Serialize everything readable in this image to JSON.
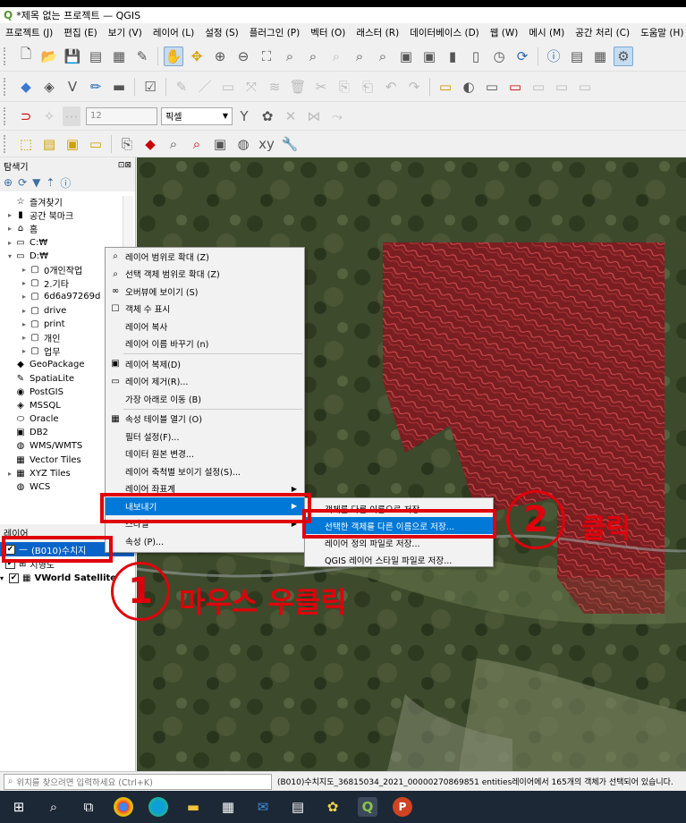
{
  "window": {
    "title": "*제목 없는 프로젝트 — QGIS",
    "logo": "qgis-logo"
  },
  "menubar": [
    "프로젝트 (J)",
    "편집 (E)",
    "보기 (V)",
    "레이어 (L)",
    "설정 (S)",
    "플러그인 (P)",
    "벡터 (O)",
    "래스터 (R)",
    "데이터베이스 (D)",
    "웹 (W)",
    "메시 (M)",
    "공간 처리 (C)",
    "도움말 (H)"
  ],
  "digitize_toolbar": {
    "font_size_value": "12",
    "unit_value": "픽셀"
  },
  "browser_panel": {
    "title": "탐색기",
    "items": [
      {
        "label": "즐겨찾기",
        "icon": "star-icon",
        "expand": ""
      },
      {
        "label": "공간 북마크",
        "icon": "bookmark-icon",
        "expand": "▸"
      },
      {
        "label": "홈",
        "icon": "home-icon",
        "expand": "▸"
      },
      {
        "label": "C:₩",
        "icon": "drive-icon",
        "expand": "▸"
      },
      {
        "label": "D:₩",
        "icon": "drive-icon",
        "expand": "▾"
      },
      {
        "label": "0개인작업",
        "icon": "folder-icon",
        "expand": "▸",
        "indent": 1
      },
      {
        "label": "2.기타",
        "icon": "folder-icon",
        "expand": "▸",
        "indent": 1
      },
      {
        "label": "6d6a97269d",
        "icon": "folder-icon",
        "expand": "▸",
        "indent": 1
      },
      {
        "label": "drive",
        "icon": "folder-icon",
        "expand": "▸",
        "indent": 1
      },
      {
        "label": "print",
        "icon": "folder-icon",
        "expand": "▸",
        "indent": 1
      },
      {
        "label": "개인",
        "icon": "folder-icon",
        "expand": "▸",
        "indent": 1
      },
      {
        "label": "업무",
        "icon": "folder-icon",
        "expand": "▸",
        "indent": 1
      },
      {
        "label": "GeoPackage",
        "icon": "geopackage-icon",
        "expand": ""
      },
      {
        "label": "SpatiaLite",
        "icon": "spatialite-icon",
        "expand": ""
      },
      {
        "label": "PostGIS",
        "icon": "postgis-icon",
        "expand": ""
      },
      {
        "label": "MSSQL",
        "icon": "mssql-icon",
        "expand": ""
      },
      {
        "label": "Oracle",
        "icon": "oracle-icon",
        "expand": ""
      },
      {
        "label": "DB2",
        "icon": "db2-icon",
        "expand": ""
      },
      {
        "label": "WMS/WMTS",
        "icon": "wms-icon",
        "expand": ""
      },
      {
        "label": "Vector Tiles",
        "icon": "vector-tiles-icon",
        "expand": ""
      },
      {
        "label": "XYZ Tiles",
        "icon": "xyz-tiles-icon",
        "expand": "▸"
      },
      {
        "label": "WCS",
        "icon": "wcs-icon",
        "expand": ""
      }
    ]
  },
  "layers_panel": {
    "title": "레이어",
    "layers": [
      {
        "label": "(B010)수치지",
        "checked": true,
        "selected": true
      },
      {
        "label": "지형도",
        "checked": true,
        "selected": false
      },
      {
        "label": "VWorld Satellite",
        "checked": true,
        "selected": false
      }
    ]
  },
  "context_menu": {
    "items": [
      {
        "label": "레이어 범위로 확대 (Z)",
        "icon": "zoom-layer-icon"
      },
      {
        "label": "선택 객체 범위로 확대 (Z)",
        "icon": "zoom-selected-icon"
      },
      {
        "label": "오버뷰에 보이기 (S)",
        "icon": "overview-icon"
      },
      {
        "label": "객체 수 표시",
        "icon": "checkbox-icon"
      },
      {
        "label": "레이어 복사",
        "icon": ""
      },
      {
        "label": "레이어 이름 바꾸기 (n)",
        "icon": ""
      },
      {
        "sep": true
      },
      {
        "label": "레이어 복제(D)",
        "icon": "duplicate-icon"
      },
      {
        "label": "레이어 제거(R)...",
        "icon": "remove-layer-icon"
      },
      {
        "label": "가장 아래로 이동 (B)",
        "icon": ""
      },
      {
        "sep": true
      },
      {
        "label": "속성 테이블 열기 (O)",
        "icon": "table-icon"
      },
      {
        "label": "필터 설정(F)...",
        "icon": ""
      },
      {
        "label": "데이터 원본 변경...",
        "icon": ""
      },
      {
        "label": "레이어 축척별 보이기 설정(S)...",
        "icon": ""
      },
      {
        "label": "레이어 좌표계",
        "icon": "",
        "submenu": true
      },
      {
        "label": "내보내기",
        "icon": "",
        "submenu": true,
        "highlight": true
      },
      {
        "label": "스타일",
        "icon": "",
        "submenu": true
      },
      {
        "label": "속성 (P)...",
        "icon": ""
      }
    ]
  },
  "export_submenu": [
    {
      "label": "객체를 다른 이름으로 저장...",
      "highlight": false
    },
    {
      "label": "선택한 객체를 다른 이름으로 저장...",
      "highlight": true
    },
    {
      "label": "레이어 정의 파일로 저장...",
      "highlight": false
    },
    {
      "label": "QGIS 레이어 스타일 파일로 저장...",
      "highlight": false
    }
  ],
  "annotations": {
    "step1_number": "1",
    "step1_text": "마우스 우클릭",
    "step2_number": "2",
    "step2_text": "클릭",
    "color": "#e0000b"
  },
  "statusbar": {
    "locator_placeholder": "위치를 찾으려면 입력하세요 (Ctrl+K)",
    "message": "(B010)수치지도_36815034_2021_00000270869851 entities레이어에서 165개의 객체가 선택되어 있습니다."
  },
  "taskbar": [
    "windows-start-icon",
    "search-icon",
    "task-view-icon",
    "chrome-icon",
    "edge-icon",
    "file-explorer-icon",
    "store-icon",
    "mail-icon",
    "app-icon",
    "app-icon-2",
    "qgis-icon",
    "powerpoint-icon"
  ]
}
